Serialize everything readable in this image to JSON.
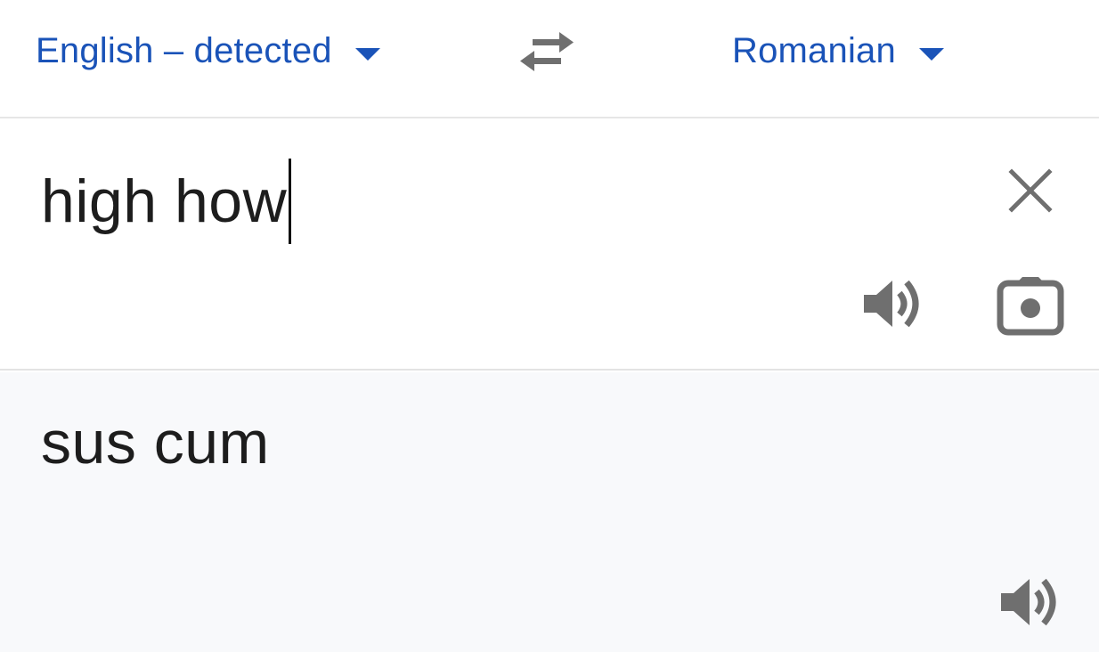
{
  "language_bar": {
    "source_language": "English – detected",
    "target_language": "Romanian",
    "swap_icon": "swap-horizontal-icon",
    "caret_icon": "caret-down-icon"
  },
  "input": {
    "text": "high how",
    "clear_icon": "close-icon",
    "speak_icon": "speaker-icon",
    "camera_icon": "camera-icon"
  },
  "output": {
    "text": "sus cum",
    "speak_icon": "speaker-icon"
  },
  "colors": {
    "accent": "#1a53b8",
    "icon_gray": "#6f6f6f",
    "output_background": "#f8f9fb",
    "text": "#1d1d1d"
  }
}
